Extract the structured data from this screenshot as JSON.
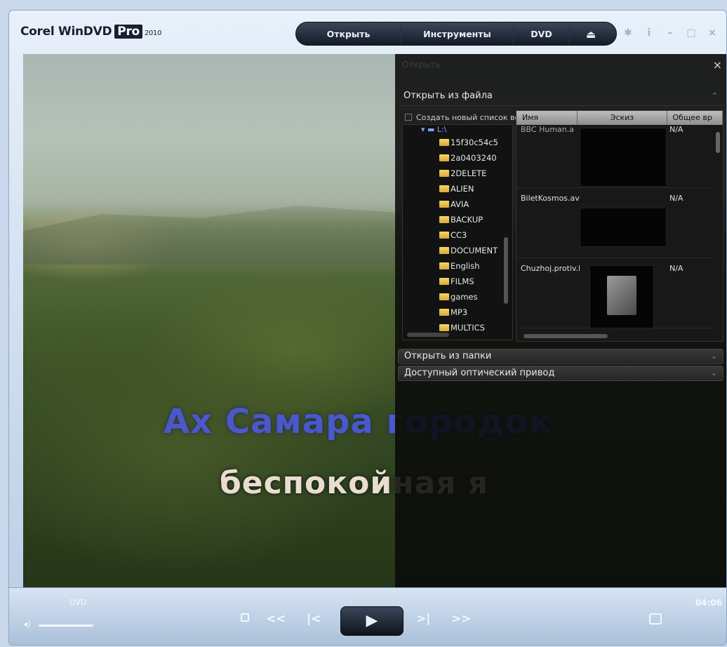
{
  "window": {
    "title": "Corel WinDVD",
    "title_pro": "Pro",
    "title_year": "2010"
  },
  "menu": {
    "open": "Открыть",
    "tools": "Инструменты",
    "dvd": "DVD",
    "eject_icon": "eject-icon"
  },
  "window_controls": {
    "settings_icon": "gear-icon",
    "info": "i",
    "minimize": "–",
    "maximize": "□",
    "close": "×"
  },
  "video": {
    "subtitle_line1": "Ах Самара городок",
    "subtitle_line2": "беспокойная я"
  },
  "open_panel": {
    "title": "Открыть",
    "close": "×",
    "section_file": "Открыть из файла",
    "new_list": "Создать новый список вос",
    "tree_root": "L:\\",
    "folders": [
      "15f30c54c5",
      "2a0403240",
      "2DELETE",
      "ALIEN",
      "AVIA",
      "BACKUP",
      "CC3",
      "DOCUMENT",
      "English",
      "FILMS",
      "games",
      "MP3",
      "MULTICS"
    ],
    "file_columns": [
      "Имя",
      "Эскиз",
      "Общее вр"
    ],
    "files": [
      {
        "name": "BBC Human.a",
        "size": "N/A"
      },
      {
        "name": "BiletKosmos.avi",
        "size": "N/A"
      },
      {
        "name": "Chuzhoj.protiv.h",
        "size": "N/A"
      }
    ],
    "section_folder": "Открыть из папки",
    "section_drive": "Доступный оптический привод"
  },
  "controls": {
    "source": "DVD",
    "time": "04:06",
    "volume_level": 0.0,
    "stop": "",
    "rewind": "<<",
    "prev": "|<",
    "play": "▶",
    "next": ">|",
    "forward": ">>"
  }
}
